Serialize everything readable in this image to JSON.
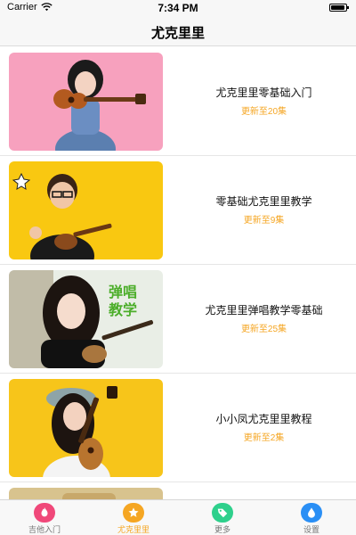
{
  "status_bar": {
    "carrier": "Carrier",
    "time": "7:34 PM"
  },
  "nav": {
    "title": "尤克里里"
  },
  "courses": [
    {
      "title": "尤克里里零基础入门",
      "subtitle": "更新至20集",
      "thumb_bg": "#f7a1be"
    },
    {
      "title": "零基础尤克里里教学",
      "subtitle": "更新至9集",
      "thumb_bg": "#f9c811"
    },
    {
      "title": "尤克里里弹唱教学零基础",
      "subtitle": "更新至25集",
      "thumb_bg": "#e9eee6"
    },
    {
      "title": "小小凤尤克里里教程",
      "subtitle": "更新至2集",
      "thumb_bg": "#f7c51a"
    },
    {
      "title": "",
      "subtitle": "",
      "thumb_bg": "#d8c38e"
    }
  ],
  "thumb_text": {
    "course_2": "",
    "course_3_line1": "弹唱",
    "course_3_line2": "教学"
  },
  "tabs": [
    {
      "label": "吉他入门",
      "icon": "flame-icon",
      "color": "#f0487a"
    },
    {
      "label": "尤克里里",
      "icon": "star-icon",
      "color": "#f5a623"
    },
    {
      "label": "更多",
      "icon": "tag-icon",
      "color": "#2ed08c"
    },
    {
      "label": "设置",
      "icon": "drop-icon",
      "color": "#2a8ff5"
    }
  ],
  "colors": {
    "accent": "#f5a623",
    "subtitle": "#f5a623"
  }
}
